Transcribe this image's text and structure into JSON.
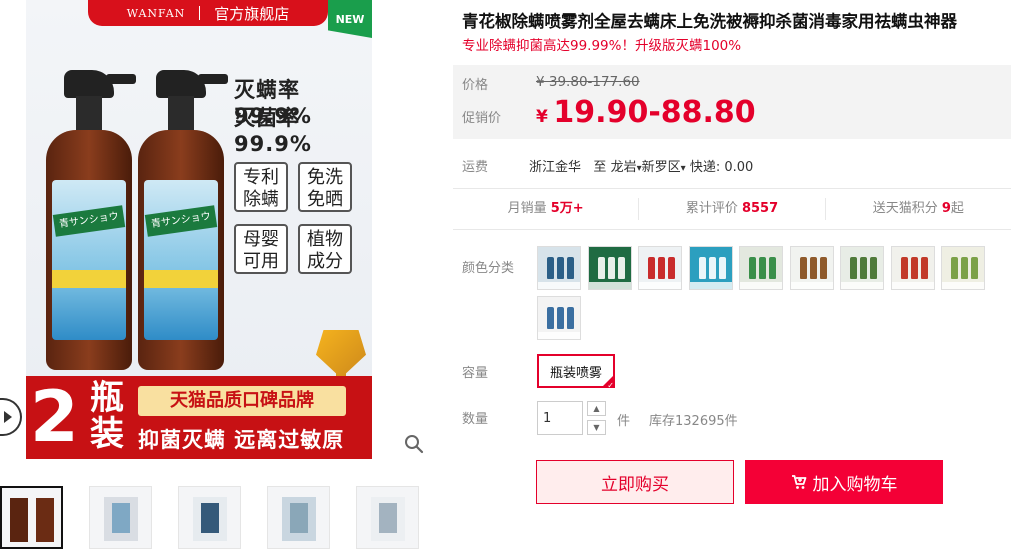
{
  "gallery": {
    "brand_logo": "WANFAN",
    "brand_store": "官方旗舰店",
    "new_badge": "NEW",
    "rates": [
      "灭螨率99.9%",
      "灭菌率99.9%"
    ],
    "tags": [
      [
        "专利",
        "除螨"
      ],
      [
        "免洗",
        "免晒"
      ],
      [
        "母婴",
        "可用"
      ],
      [
        "植物",
        "成分"
      ]
    ],
    "bottle_label": "青サンショウ",
    "promo_count": "2",
    "promo_unit": "瓶装",
    "promo_gold": "天猫品质口碑品牌",
    "promo_slogan": "抑菌灭螨 远离过敏原",
    "thumbnail_count": 5
  },
  "product": {
    "title": "青花椒除螨喷雾剂全屋去螨床上免洗被褥抑杀菌消毒家用祛螨虫神器",
    "subtitle": "专业除螨抑菌高达99.99%！升级版灭螨100%"
  },
  "price": {
    "orig_label": "价格",
    "orig_value": "¥ 39.80-177.60",
    "sale_label": "促销价",
    "sale_currency": "¥",
    "sale_value": "19.90-88.80"
  },
  "shipping": {
    "label": "运费",
    "from": "浙江金华",
    "to_prefix": "至",
    "city": "龙岩",
    "district": "新罗区",
    "express": "快递: 0.00"
  },
  "stats": [
    {
      "label": "月销量",
      "value": "5万+"
    },
    {
      "label": "累计评价",
      "value": "8557"
    },
    {
      "label": "送天猫积分",
      "value": "9",
      "suffix": "起"
    }
  ],
  "color": {
    "label": "颜色分类",
    "swatches": [
      {
        "bg": "#d7e3ea",
        "accent": "#2b5f87"
      },
      {
        "bg": "#1f6b42",
        "accent": "#e9f0ea"
      },
      {
        "bg": "#eef2f4",
        "accent": "#c92c2c"
      },
      {
        "bg": "#2c9fbf",
        "accent": "#eaf6fa"
      },
      {
        "bg": "#e3e8df",
        "accent": "#3a8f4a"
      },
      {
        "bg": "#f1f3f0",
        "accent": "#8f5a2b"
      },
      {
        "bg": "#e8ede6",
        "accent": "#4f7a3a"
      },
      {
        "bg": "#f1f1ec",
        "accent": "#c23a2a"
      },
      {
        "bg": "#efefe3",
        "accent": "#7ca148"
      },
      {
        "bg": "#f3f3f3",
        "accent": "#3b6fa1"
      }
    ]
  },
  "capacity": {
    "label": "容量",
    "selected": "瓶装喷雾"
  },
  "quantity": {
    "label": "数量",
    "value": "1",
    "unit": "件",
    "stock": "库存132695件"
  },
  "actions": {
    "buy_now": "立即购买",
    "add_cart": "加入购物车"
  }
}
